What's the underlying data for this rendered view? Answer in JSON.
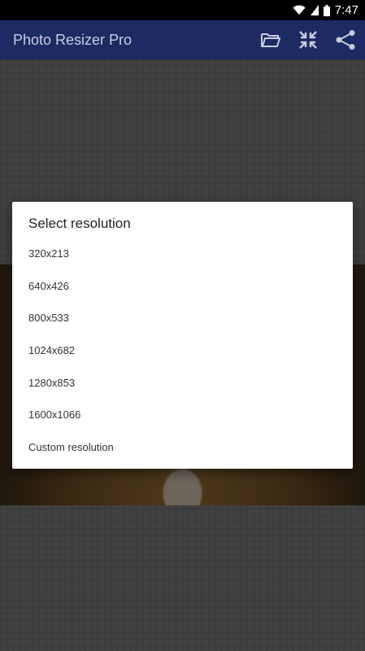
{
  "status_bar": {
    "time": "7:47",
    "icons": [
      "wifi-icon",
      "signal-icon",
      "battery-icon"
    ]
  },
  "app_bar": {
    "title": "Photo Resizer Pro",
    "background_color": "#1e2a64",
    "actions": [
      "folder-open-icon",
      "compress-icon",
      "share-icon"
    ]
  },
  "dialog": {
    "title": "Select resolution",
    "options": [
      "320x213",
      "640x426",
      "800x533",
      "1024x682",
      "1280x853",
      "1600x1066",
      "Custom resolution"
    ]
  }
}
